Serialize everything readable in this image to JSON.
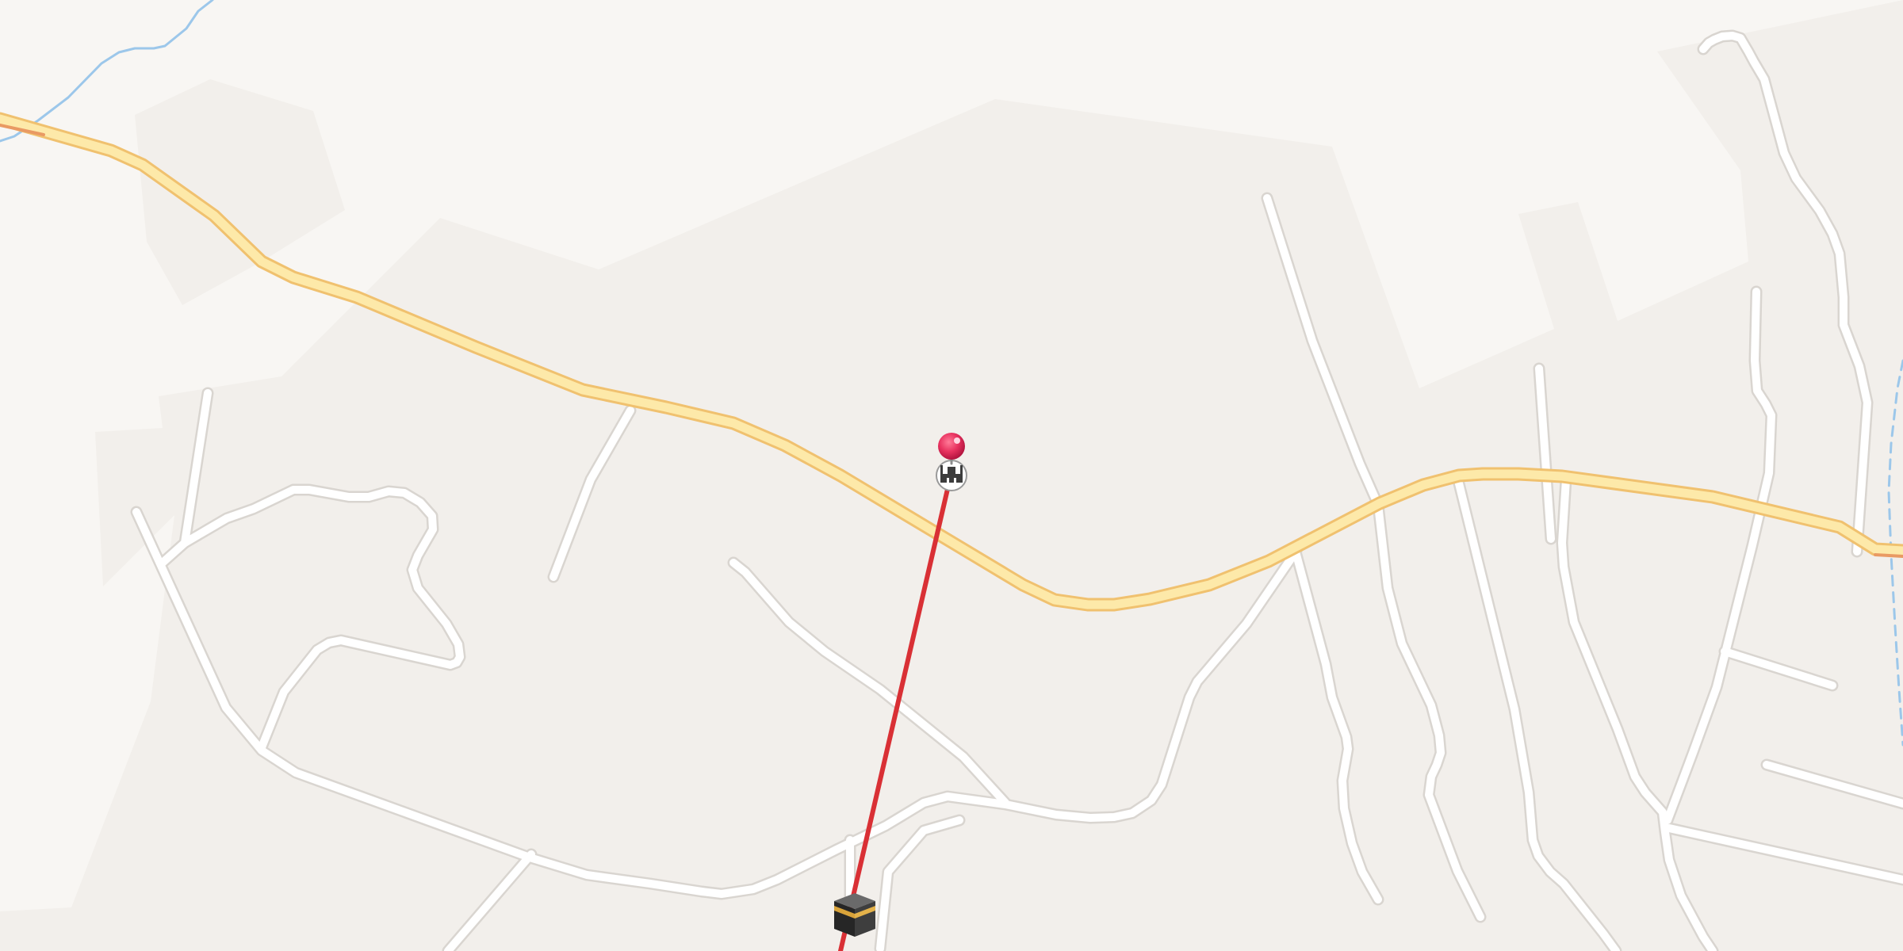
{
  "map": {
    "colors": {
      "background": "#f8f6f3",
      "landuse": "#f2efeb",
      "minor_road": "#ffffff",
      "minor_road_casing": "#d9d5d0",
      "main_road": "#fde9a9",
      "main_road_casing": "#f0c16f",
      "main_road_edge": "#e99a63",
      "waterway": "#9cc7ea",
      "qibla_line": "#d93035",
      "pin": "#e8325f"
    },
    "markers": {
      "location_pin": "location-pin-icon",
      "mosque": "mosque-icon",
      "kaaba": "kaaba-icon"
    },
    "qibla_line_visible": true
  }
}
